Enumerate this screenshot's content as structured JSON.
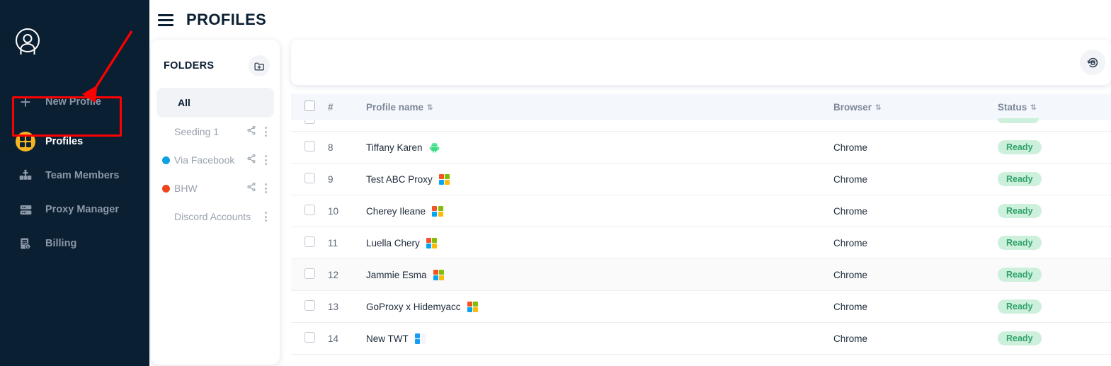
{
  "sidebar": {
    "avatar_name": "user-avatar",
    "items": [
      {
        "label": "New Profile",
        "icon": "plus-icon",
        "active": false
      },
      {
        "label": "Profiles",
        "icon": "grid-icon",
        "active": true
      },
      {
        "label": "Team Members",
        "icon": "team-icon",
        "active": false
      },
      {
        "label": "Proxy Manager",
        "icon": "server-icon",
        "active": false
      },
      {
        "label": "Billing",
        "icon": "invoice-icon",
        "active": false
      }
    ],
    "bg_color": "#0b1f33",
    "accent_color": "#f5b422",
    "annotation_color": "#fe0000"
  },
  "header": {
    "menu_icon": "hamburger-icon",
    "title": "PROFILES"
  },
  "folders": {
    "title": "FOLDERS",
    "add_button_icon": "folder-plus-icon",
    "items": [
      {
        "label": "All",
        "dot_color": "",
        "selected": true,
        "share": false
      },
      {
        "label": "Seeding 1",
        "dot_color": "",
        "selected": false,
        "share": true
      },
      {
        "label": "Via Facebook",
        "dot_color": "#0f9fe3",
        "selected": false,
        "share": true
      },
      {
        "label": "BHW",
        "dot_color": "#f0441c",
        "selected": false,
        "share": true
      },
      {
        "label": "Discord Accounts",
        "dot_color": "",
        "selected": false,
        "share": false
      }
    ]
  },
  "toolbar": {
    "refresh_icon": "refresh-profile-icon"
  },
  "table": {
    "columns": [
      {
        "key": "check",
        "label": ""
      },
      {
        "key": "num",
        "label": "#"
      },
      {
        "key": "name",
        "label": "Profile name",
        "sortable": true
      },
      {
        "key": "browser",
        "label": "Browser",
        "sortable": true
      },
      {
        "key": "status",
        "label": "Status",
        "sortable": true
      }
    ],
    "rows": [
      {
        "num": "8",
        "name": "Tiffany Karen",
        "os": "android",
        "browser": "Chrome",
        "status": "Ready",
        "hovered": false
      },
      {
        "num": "9",
        "name": "Test ABC Proxy",
        "os": "windows",
        "browser": "Chrome",
        "status": "Ready",
        "hovered": false
      },
      {
        "num": "10",
        "name": "Cherey Ileane",
        "os": "windows",
        "browser": "Chrome",
        "status": "Ready",
        "hovered": false
      },
      {
        "num": "11",
        "name": "Luella Chery",
        "os": "windows",
        "browser": "Chrome",
        "status": "Ready",
        "hovered": false
      },
      {
        "num": "12",
        "name": "Jammie Esma",
        "os": "windows",
        "browser": "Chrome",
        "status": "Ready",
        "hovered": true
      },
      {
        "num": "13",
        "name": "GoProxy x Hidemyacc",
        "os": "windows",
        "browser": "Chrome",
        "status": "Ready",
        "hovered": false
      },
      {
        "num": "14",
        "name": "New TWT",
        "os": "bluewin",
        "browser": "Chrome",
        "status": "Ready",
        "hovered": false
      }
    ],
    "status_colors": {
      "ready_bg": "#cdf0dd",
      "ready_text": "#2fa36b"
    },
    "header_bg": "#f4f8fd"
  }
}
